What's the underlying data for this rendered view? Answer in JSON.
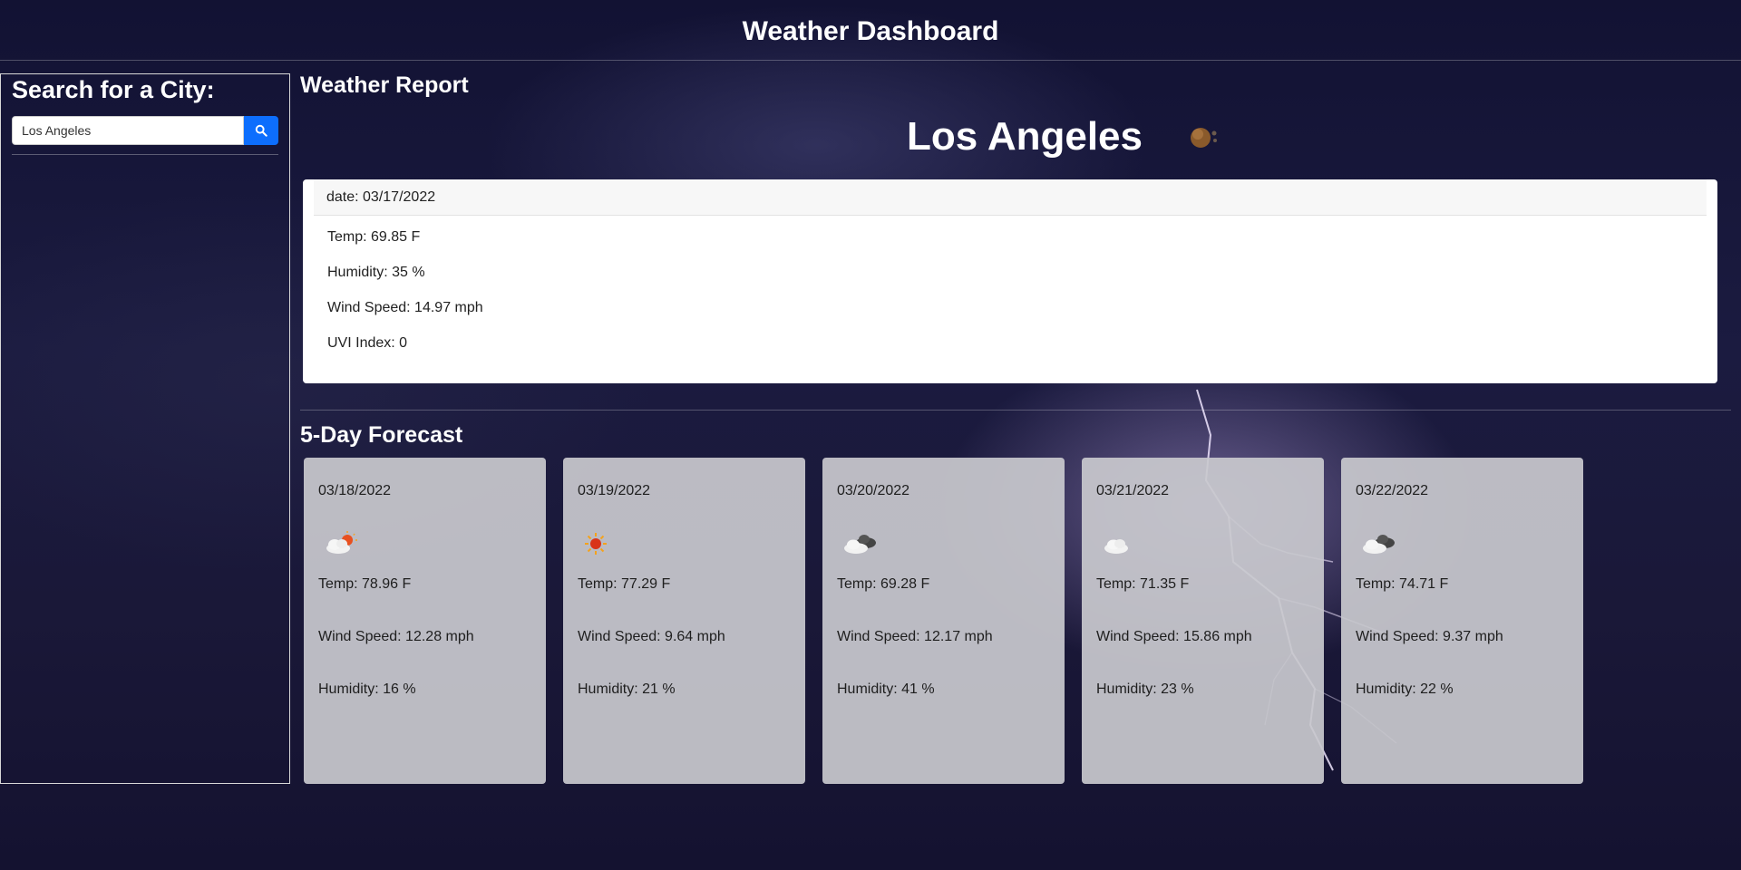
{
  "header": {
    "title": "Weather Dashboard"
  },
  "sidebar": {
    "title": "Search for a City:",
    "search": {
      "value": "Los Angeles",
      "icon": "search-icon"
    }
  },
  "report": {
    "heading": "Weather Report",
    "city": "Los Angeles",
    "icon": "moon-clouds-icon",
    "date_label": "date: 03/17/2022",
    "temp": "Temp: 69.85 F",
    "humidity": "Humidity: 35 %",
    "wind": "Wind Speed: 14.97 mph",
    "uvi": "UVI Index: 0"
  },
  "forecast": {
    "heading": "5-Day Forecast",
    "days": [
      {
        "date": "03/18/2022",
        "icon": "partly-cloudy-sun-icon",
        "temp": "Temp: 78.96 F",
        "wind": "Wind Speed: 12.28 mph",
        "humidity": "Humidity: 16 %"
      },
      {
        "date": "03/19/2022",
        "icon": "sun-icon",
        "temp": "Temp: 77.29 F",
        "wind": "Wind Speed: 9.64 mph",
        "humidity": "Humidity: 21 %"
      },
      {
        "date": "03/20/2022",
        "icon": "broken-clouds-icon",
        "temp": "Temp: 69.28 F",
        "wind": "Wind Speed: 12.17 mph",
        "humidity": "Humidity: 41 %"
      },
      {
        "date": "03/21/2022",
        "icon": "cloud-icon",
        "temp": "Temp: 71.35 F",
        "wind": "Wind Speed: 15.86 mph",
        "humidity": "Humidity: 23 %"
      },
      {
        "date": "03/22/2022",
        "icon": "broken-clouds-icon",
        "temp": "Temp: 74.71 F",
        "wind": "Wind Speed: 9.37 mph",
        "humidity": "Humidity: 22 %"
      }
    ]
  },
  "colors": {
    "accent": "#0d6efd",
    "background": "#1a1838"
  }
}
